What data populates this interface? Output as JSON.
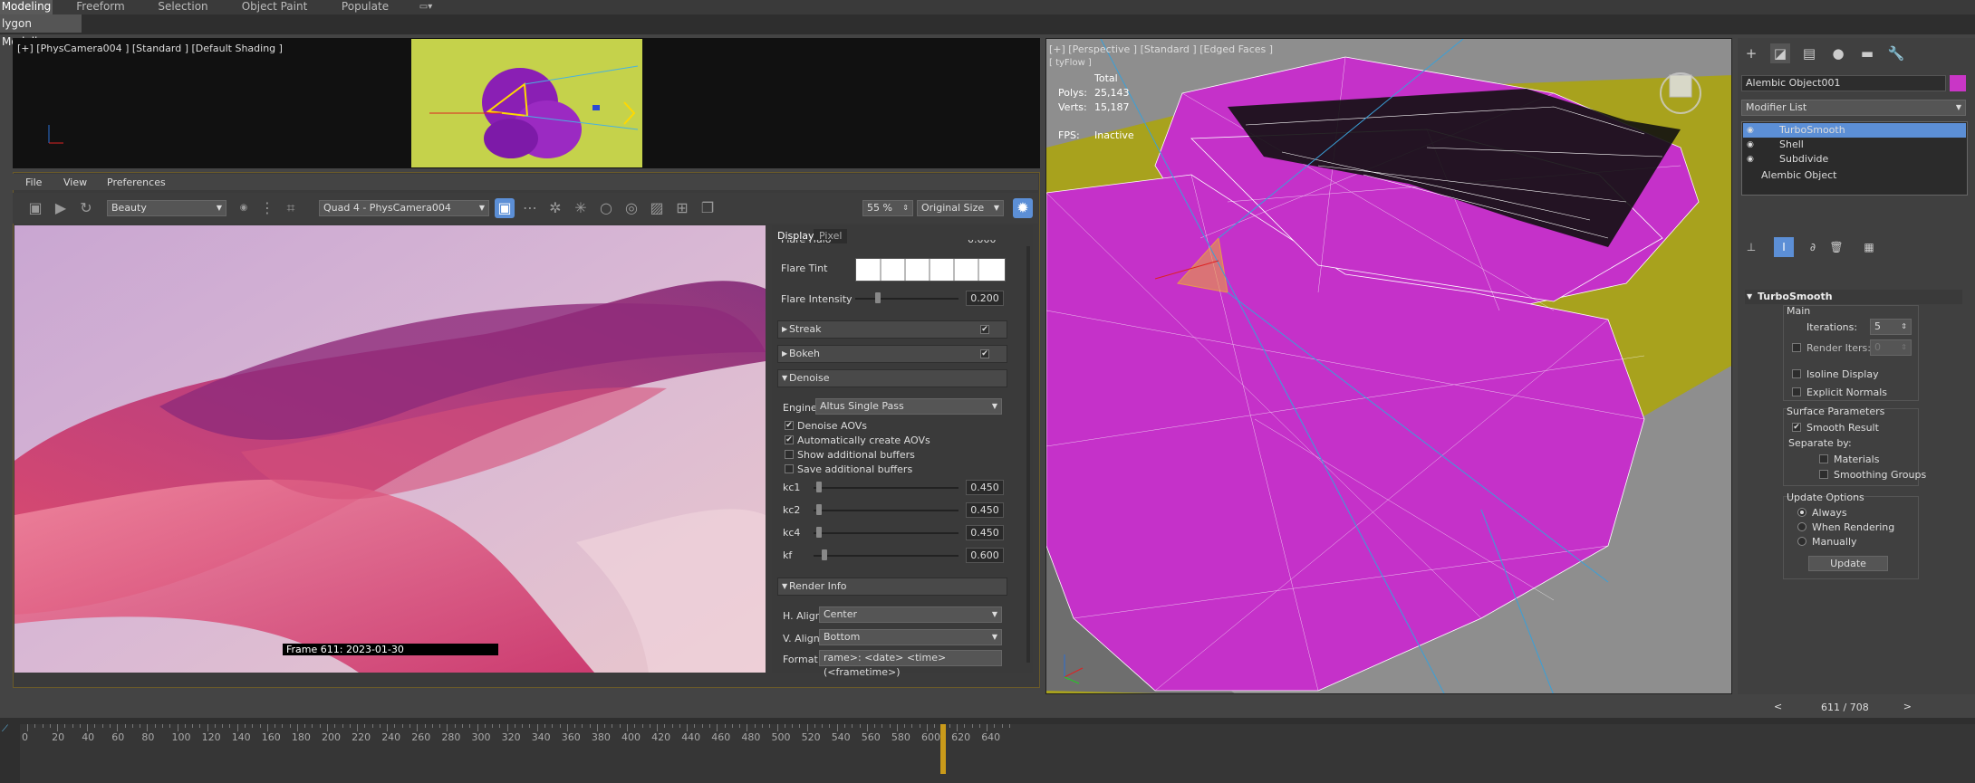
{
  "ribbon": {
    "tabs": [
      "Modeling",
      "Freeform",
      "Selection",
      "Object Paint",
      "Populate"
    ],
    "active": "Modeling",
    "sub_label": "lygon Modeling"
  },
  "camera_viewport": {
    "label": "[+] [PhysCamera004 ] [Standard ] [Default Shading ]"
  },
  "frame_buffer": {
    "menu": [
      "File",
      "View",
      "Preferences"
    ],
    "channel": "Beauty",
    "view": "Quad 4 - PhysCamera004",
    "zoom": "55 %",
    "size_mode": "Original Size",
    "stamp": "Frame  611:  2023-01-30"
  },
  "settings_panel": {
    "tabs": [
      "Display",
      "Pixel"
    ],
    "flare_halo_label": "Flare Halo",
    "flare_halo_value": "0.000",
    "flare_tint_label": "Flare Tint",
    "flare_intensity_label": "Flare Intensity",
    "flare_intensity_value": "0.200",
    "flare_intensity_fraction": 0.2,
    "sections": {
      "streak": "Streak",
      "bokeh": "Bokeh",
      "denoise": "Denoise",
      "render_info": "Render Info"
    },
    "engine_label": "Engine",
    "engine_value": "Altus Single Pass",
    "checks": [
      {
        "label": "Denoise AOVs",
        "checked": true
      },
      {
        "label": "Automatically create AOVs",
        "checked": true
      },
      {
        "label": "Show additional buffers",
        "checked": false
      },
      {
        "label": "Save additional buffers",
        "checked": false
      }
    ],
    "sliders": [
      {
        "label": "kc1",
        "value": "0.450",
        "fraction": 0.02
      },
      {
        "label": "kc2",
        "value": "0.450",
        "fraction": 0.02
      },
      {
        "label": "kc4",
        "value": "0.450",
        "fraction": 0.02
      },
      {
        "label": "kf",
        "value": "0.600",
        "fraction": 0.06
      }
    ],
    "h_align_label": "H. Align",
    "h_align_value": "Center",
    "v_align_label": "V. Align",
    "v_align_value": "Bottom",
    "format_label": "Format",
    "format_value": "rame>: <date> <time> (<frametime>)"
  },
  "perspective_viewport": {
    "label": "[+] [Perspective ] [Standard ] [Edged Faces ]",
    "sublabel": "[ tyFlow ]",
    "stats_header": "Total",
    "polys_label": "Polys:",
    "polys_value": "25,143",
    "verts_label": "Verts:",
    "verts_value": "15,187",
    "fps_label": "FPS:",
    "fps_value": "Inactive"
  },
  "command_panel": {
    "object_name": "Alembic Object001",
    "modifier_list": "Modifier List",
    "stack": [
      "TurboSmooth",
      "Shell",
      "Subdivide",
      "Alembic Object"
    ],
    "selected": "TurboSmooth",
    "rollout_title": "TurboSmooth",
    "main_label": "Main",
    "iterations_label": "Iterations:",
    "iterations_value": "5",
    "render_iters_label": "Render Iters:",
    "render_iters_value": "0",
    "isoline_label": "Isoline Display",
    "explicit_label": "Explicit Normals",
    "surface_label": "Surface Parameters",
    "smooth_result_label": "Smooth Result",
    "separate_by_label": "Separate by:",
    "materials_label": "Materials",
    "smoothing_groups_label": "Smoothing Groups",
    "update_options_label": "Update Options",
    "always_label": "Always",
    "when_rendering_label": "When Rendering",
    "manually_label": "Manually",
    "update_button": "Update"
  },
  "timeline": {
    "frame_counter": "611 / 708",
    "current_frame": 611,
    "ticks": [
      0,
      20,
      40,
      60,
      80,
      100,
      120,
      140,
      160,
      180,
      200,
      220,
      240,
      260,
      280,
      300,
      320,
      340,
      360,
      380,
      400,
      420,
      440,
      460,
      480,
      500,
      520,
      540,
      560,
      580,
      600,
      620,
      640
    ]
  },
  "colors": {
    "accent_blue": "#5c8fd6",
    "viewport_yellow_green": "#a6a41c",
    "mesh_magenta": "#cc33cc",
    "frame_border": "#6a5a2a"
  }
}
